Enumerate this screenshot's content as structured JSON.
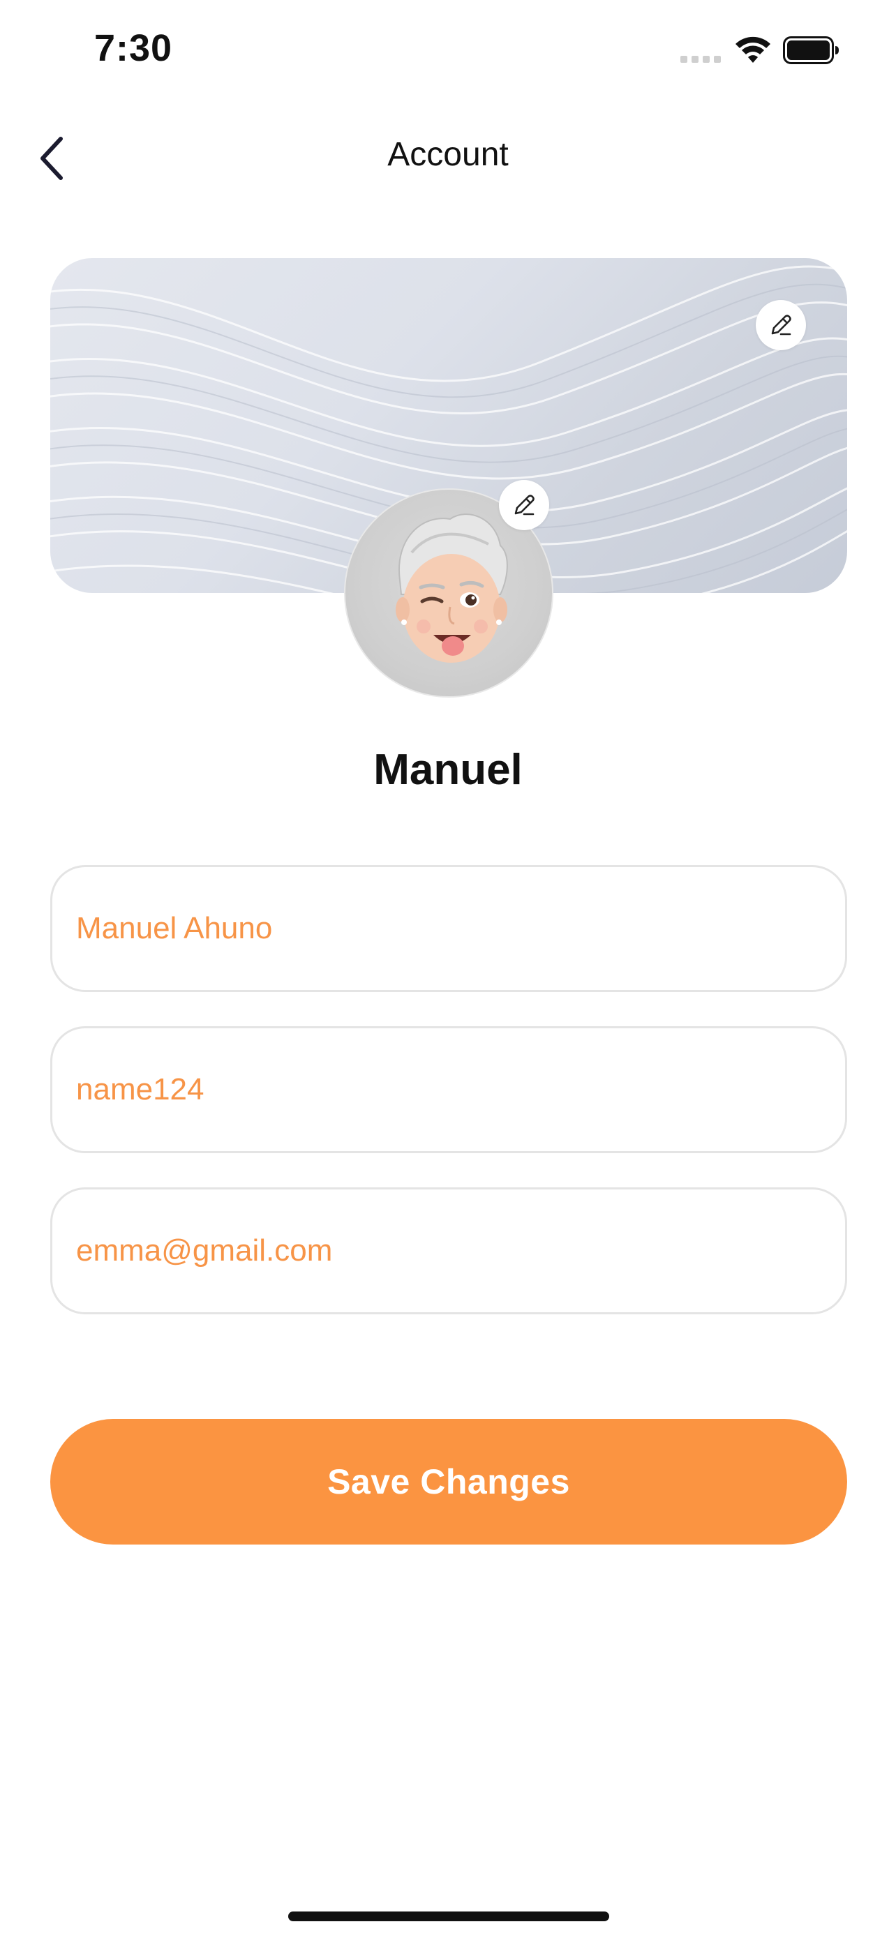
{
  "status_bar": {
    "time": "7:30"
  },
  "header": {
    "title": "Account"
  },
  "profile": {
    "display_name": "Manuel"
  },
  "form": {
    "full_name": {
      "value": "Manuel Ahuno"
    },
    "username": {
      "value": "name124"
    },
    "email": {
      "value": "emma@gmail.com"
    }
  },
  "actions": {
    "save_label": "Save Changes"
  },
  "colors": {
    "accent": "#fb9441",
    "field_text": "#f79447",
    "border": "#e4e4e4",
    "text_primary": "#111111"
  },
  "icons": {
    "back": "chevron-left-icon",
    "cover_edit": "pencil-icon",
    "avatar_edit": "pencil-icon"
  }
}
